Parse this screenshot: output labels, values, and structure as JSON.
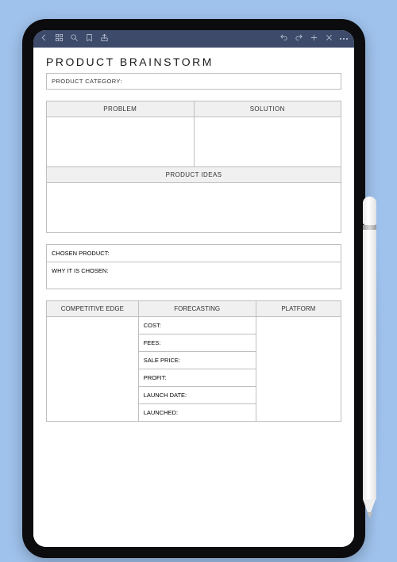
{
  "doc": {
    "title": "PRODUCT BRAINSTORM",
    "category_label": "PRODUCT CATEGORY:",
    "problem_header": "PROBLEM",
    "solution_header": "SOLUTION",
    "ideas_header": "PRODUCT IDEAS",
    "chosen_product_label": "CHOSEN PRODUCT:",
    "why_chosen_label": "WHY IT IS CHOSEN:",
    "competitive_header": "COMPETITIVE EDGE",
    "forecasting_header": "FORECASTING",
    "platform_header": "PLATFORM",
    "forecasting_rows": {
      "cost": "COST:",
      "fees": "FEES:",
      "sale_price": "SALE PRICE:",
      "profit": "PROFIT:",
      "launch_date": "LAUNCH DATE:",
      "launched": "LAUNCHED:"
    }
  }
}
